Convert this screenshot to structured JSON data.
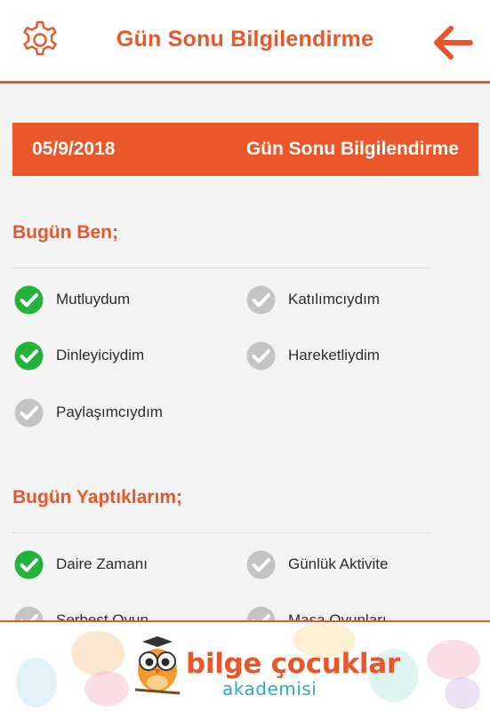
{
  "header": {
    "title": "Gün Sonu Bilgilendirme",
    "settings_icon": "gear-icon",
    "back_icon": "arrow-left-icon"
  },
  "banner": {
    "date": "05/9/2018",
    "title": "Gün Sonu Bilgilendirme"
  },
  "sections": [
    {
      "title": "Bugün Ben;",
      "items": [
        {
          "label": "Mutluydum",
          "checked": true
        },
        {
          "label": "Katılımcıydım",
          "checked": false
        },
        {
          "label": "Dinleyiciydim",
          "checked": true
        },
        {
          "label": "Hareketliydim",
          "checked": false
        },
        {
          "label": "Paylaşımcıydım",
          "checked": false
        }
      ]
    },
    {
      "title": "Bugün Yaptıklarım;",
      "items": [
        {
          "label": "Daire Zamanı",
          "checked": true
        },
        {
          "label": "Günlük Aktivite",
          "checked": false
        },
        {
          "label": "Serbest Oyun",
          "checked": false
        },
        {
          "label": "Masa Oyunları",
          "checked": false
        }
      ]
    }
  ],
  "footer_ad": {
    "brand_name": "bilge çocuklar",
    "brand_sub": "akademisi"
  },
  "colors": {
    "accent": "#e8562a",
    "checked": "#22b33a",
    "unchecked": "#c4c4c4"
  }
}
